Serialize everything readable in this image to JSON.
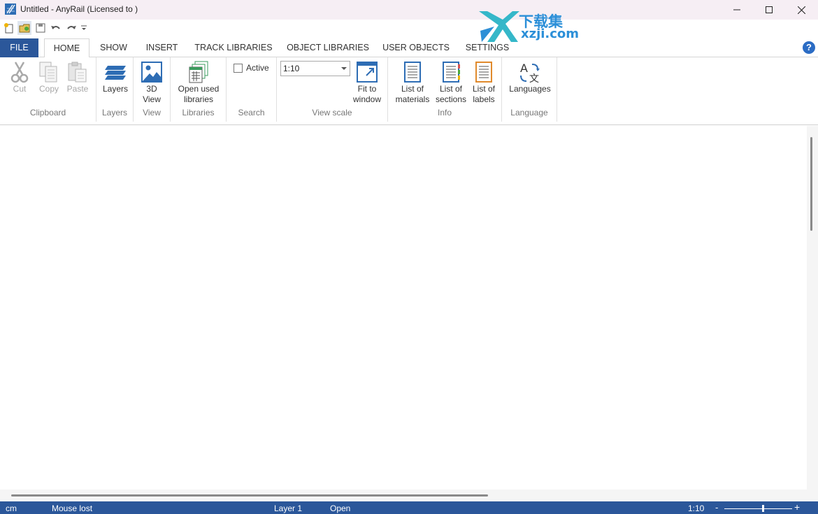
{
  "window": {
    "title": "Untitled - AnyRail (Licensed to )"
  },
  "watermark": {
    "cn_text": "下载集",
    "url_text": "xzji.com"
  },
  "quick_access": [
    "new-icon",
    "open-icon",
    "save-icon",
    "undo-icon",
    "redo-icon",
    "customize-icon"
  ],
  "tabs": {
    "file": "FILE",
    "home": "HOME",
    "show": "SHOW",
    "insert": "INSERT",
    "track_libraries": "TRACK LIBRARIES",
    "object_libraries": "OBJECT LIBRARIES",
    "user_objects": "USER OBJECTS",
    "settings": "SETTINGS",
    "active": "HOME"
  },
  "ribbon": {
    "clipboard": {
      "label": "Clipboard",
      "cut": "Cut",
      "copy": "Copy",
      "paste": "Paste"
    },
    "layers": {
      "label": "Layers",
      "button": "Layers"
    },
    "view": {
      "label": "View",
      "button_line1": "3D",
      "button_line2": "View"
    },
    "libraries": {
      "label": "Libraries",
      "button_line1": "Open used",
      "button_line2": "libraries"
    },
    "search": {
      "label": "Search",
      "active": "Active",
      "active_checked": false
    },
    "view_scale": {
      "label": "View scale",
      "scale": "1:10",
      "fit_line1": "Fit to",
      "fit_line2": "window"
    },
    "info": {
      "label": "Info",
      "materials_line1": "List of",
      "materials_line2": "materials",
      "sections_line1": "List of",
      "sections_line2": "sections",
      "labels_line1": "List of",
      "labels_line2": "labels"
    },
    "language": {
      "label": "Language",
      "button": "Languages"
    }
  },
  "status": {
    "unit": "cm",
    "mouse": "Mouse lost",
    "layer": "Layer 1",
    "state": "Open",
    "scale": "1:10",
    "zoom_minus": "-",
    "zoom_plus": "+",
    "zoom_level": 0.57
  },
  "colors": {
    "accent": "#2b579a",
    "titlebar": "#f6eef4",
    "icon_blue": "#2e6db4"
  }
}
